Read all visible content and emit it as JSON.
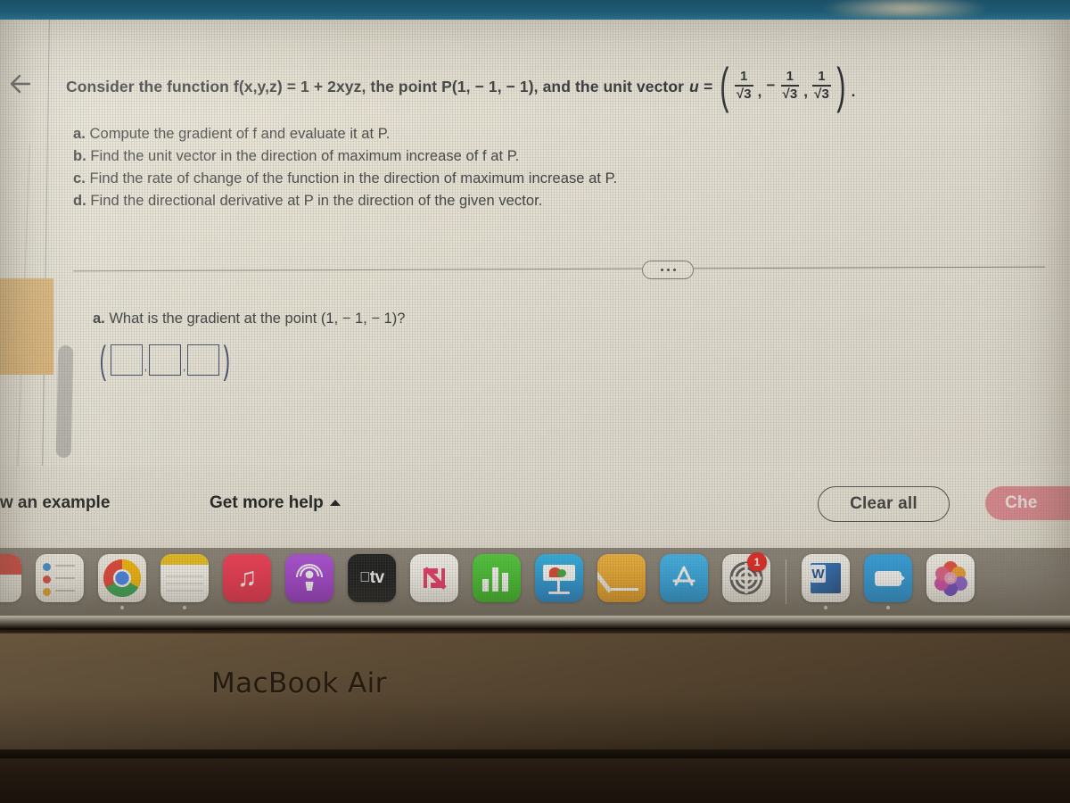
{
  "device": {
    "model_label": "MacBook Air"
  },
  "browser": {
    "back_icon": "back-arrow-icon"
  },
  "problem": {
    "lead_text": "Consider the function f(x,y,z) = 1 + 2xyz, the point P(1, − 1, − 1), and the unit vector",
    "unit_vector_label": "u =",
    "unit_vector": {
      "open": "(",
      "close": ")",
      "period": ".",
      "components": [
        {
          "sign": "",
          "numerator": "1",
          "denominator": "√3"
        },
        {
          "sign": "−",
          "numerator": "1",
          "denominator": "√3"
        },
        {
          "sign": "",
          "numerator": "1",
          "denominator": "√3"
        }
      ],
      "separator": ","
    },
    "parts": [
      {
        "label": "a.",
        "text": "Compute the gradient of f and evaluate it at P."
      },
      {
        "label": "b.",
        "text": "Find the unit vector in the direction of maximum increase of f at P."
      },
      {
        "label": "c.",
        "text": "Find the rate of change of the function in the direction of maximum increase at P."
      },
      {
        "label": "d.",
        "text": "Find the directional derivative at P in the direction of the given vector."
      }
    ]
  },
  "subquestion": {
    "label": "a.",
    "text": "What is the gradient at the point (1, − 1, − 1)?",
    "answer": {
      "open_bracket": "(",
      "close_bracket": ")",
      "separator": ",",
      "boxes": [
        "",
        "",
        ""
      ]
    }
  },
  "ellipsis_button": {
    "label": "···"
  },
  "footer": {
    "view_example": "iew an example",
    "get_more_help": "Get more help",
    "caret_icon": "caret-up-icon",
    "clear_all": "Clear all",
    "check_answer": "Che"
  },
  "dock": {
    "items": [
      {
        "name": "unknown-red-app",
        "label": "",
        "running": false,
        "badge": ""
      },
      {
        "name": "reminders",
        "label": "Reminders",
        "running": false,
        "badge": ""
      },
      {
        "name": "google-chrome",
        "label": "Google Chrome",
        "running": true,
        "badge": ""
      },
      {
        "name": "notes",
        "label": "Notes",
        "running": true,
        "badge": ""
      },
      {
        "name": "music",
        "label": "Music",
        "running": false,
        "badge": ""
      },
      {
        "name": "podcasts",
        "label": "Podcasts",
        "running": false,
        "badge": ""
      },
      {
        "name": "apple-tv",
        "label": "TV",
        "running": false,
        "badge": ""
      },
      {
        "name": "news",
        "label": "News",
        "running": false,
        "badge": ""
      },
      {
        "name": "numbers",
        "label": "Numbers",
        "running": false,
        "badge": ""
      },
      {
        "name": "keynote",
        "label": "Keynote",
        "running": false,
        "badge": ""
      },
      {
        "name": "pages",
        "label": "Pages",
        "running": false,
        "badge": ""
      },
      {
        "name": "app-store",
        "label": "App Store",
        "running": false,
        "badge": ""
      },
      {
        "name": "system-settings",
        "label": "System Settings",
        "running": false,
        "badge": "1"
      },
      {
        "name": "microsoft-word",
        "label": "Microsoft Word",
        "running": true,
        "badge": "",
        "glyph": "W"
      },
      {
        "name": "zoom",
        "label": "Zoom",
        "running": true,
        "badge": ""
      },
      {
        "name": "photos",
        "label": "Photos",
        "running": false,
        "badge": ""
      }
    ],
    "separator_after_index": 12
  },
  "colors": {
    "wall_band": "#1d5a73",
    "screen_bg": "#e9e6da",
    "answer_box_border": "#2b3763",
    "check_button_bg": "#e08a92",
    "dock_bg": "#857e73",
    "bezel": "#4f3f2b",
    "tan_block": "#e0b268",
    "badge_red": "#e8231f"
  }
}
